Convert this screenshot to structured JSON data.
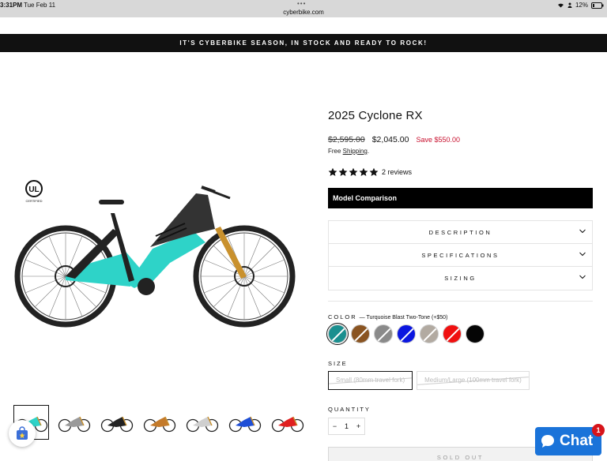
{
  "status_bar": {
    "time": "3:31PM",
    "date": "Tue Feb 11",
    "url": "cyberbike.com",
    "battery": "12%"
  },
  "announcement": "IT'S CYBERBIKE SEASON, IN STOCK AND READY TO ROCK!",
  "product": {
    "title": "2025 Cyclone RX",
    "price_old": "$2,595.00",
    "price_new": "$2,045.00",
    "save": "Save $550.00",
    "shipping_prefix": "Free ",
    "shipping_link": "Shipping",
    "shipping_suffix": ".",
    "rating": 5,
    "reviews": "2 reviews",
    "model_comparison": "Model Comparison",
    "accordion": [
      "DESCRIPTION",
      "SPECIFICATIONS",
      "SIZING"
    ],
    "color_label": "COLOR",
    "color_selected": "— Turquoise Blast Two-Tone (+$50)",
    "colors": [
      {
        "hex": "#1a8f8f",
        "active": true,
        "unavailable": true
      },
      {
        "hex": "#8a5421",
        "active": false,
        "unavailable": true
      },
      {
        "hex": "#8a8a8a",
        "active": false,
        "unavailable": true
      },
      {
        "hex": "#0b16e0",
        "active": false,
        "unavailable": true
      },
      {
        "hex": "#b2aaa1",
        "active": false,
        "unavailable": true
      },
      {
        "hex": "#f01010",
        "active": false,
        "unavailable": true
      },
      {
        "hex": "#050505",
        "active": false,
        "unavailable": false
      }
    ],
    "size_label": "SIZE",
    "sizes": [
      "Small (80mm travel fork)",
      "Medium/Large (100mm travel fork)"
    ],
    "quantity_label": "QUANTITY",
    "quantity": "1",
    "minus": "−",
    "plus": "+",
    "sold_out": "SOLD OUT",
    "thumbnail_count": 7
  },
  "chat": {
    "label": "Chat",
    "badge": "1"
  },
  "colors": {
    "accent": "#1a73d9",
    "sale": "#c8102e",
    "frame": "#2ed3c8"
  }
}
